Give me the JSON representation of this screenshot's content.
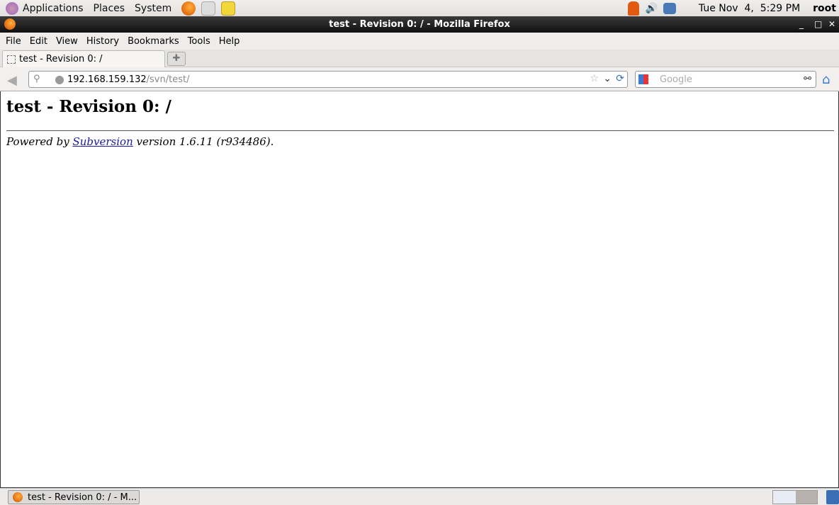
{
  "top_panel": {
    "menus": [
      "Applications",
      "Places",
      "System"
    ],
    "clock": "Tue Nov  4,  5:29 PM",
    "user": "root",
    "icons": [
      "gnome-foot-icon",
      "firefox-icon",
      "evolution-mail-icon",
      "notes-icon",
      "alert-icon",
      "volume-icon",
      "network-icon"
    ]
  },
  "window": {
    "title": "test - Revision 0: / - Mozilla Firefox"
  },
  "menubar": [
    "File",
    "Edit",
    "View",
    "History",
    "Bookmarks",
    "Tools",
    "Help"
  ],
  "tab": {
    "label": "test - Revision 0: /"
  },
  "navbar": {
    "url_host": "192.168.159.132",
    "url_path": "/svn/test/",
    "search_placeholder": "Google"
  },
  "page": {
    "heading": "test - Revision 0: /",
    "powered_prefix": "Powered by ",
    "link": "Subversion",
    "powered_suffix": " version 1.6.11 (r934486)."
  },
  "taskbar": {
    "task_label": "test - Revision 0: / - M..."
  }
}
